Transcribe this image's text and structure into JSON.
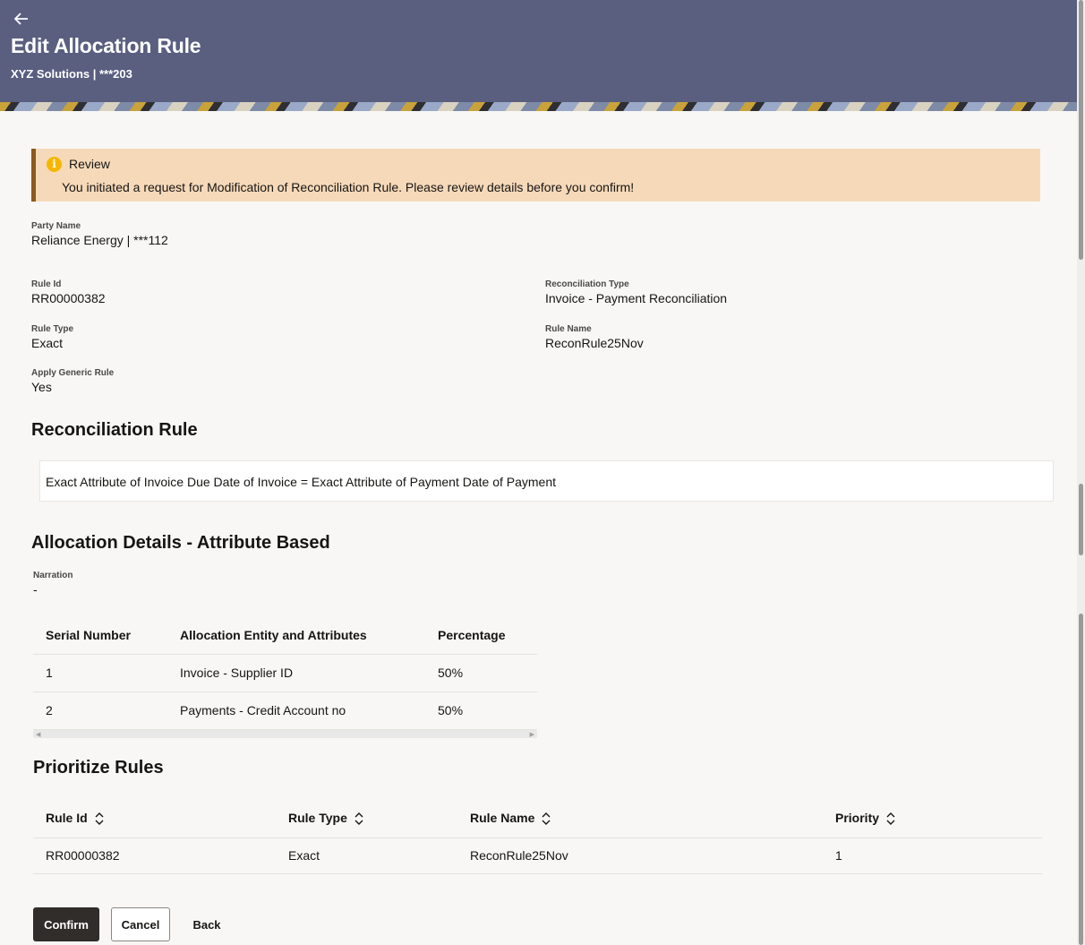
{
  "header": {
    "title": "Edit Allocation Rule",
    "subtitle": "XYZ Solutions | ***203"
  },
  "review": {
    "title": "Review",
    "message": "You initiated a request for Modification of Reconciliation Rule. Please review details before you confirm!"
  },
  "details": {
    "party_name_label": "Party Name",
    "party_name_value": "Reliance Energy | ***112",
    "rule_id_label": "Rule Id",
    "rule_id_value": "RR00000382",
    "recon_type_label": "Reconciliation Type",
    "recon_type_value": "Invoice - Payment Reconciliation",
    "rule_type_label": "Rule Type",
    "rule_type_value": "Exact",
    "rule_name_label": "Rule Name",
    "rule_name_value": "ReconRule25Nov",
    "apply_generic_label": "Apply Generic Rule",
    "apply_generic_value": "Yes"
  },
  "reconciliation_rule": {
    "heading": "Reconciliation Rule",
    "text": "Exact Attribute of Invoice Due Date of Invoice = Exact Attribute of Payment Date of Payment"
  },
  "allocation": {
    "heading": "Allocation Details - Attribute Based",
    "narration_label": "Narration",
    "narration_value": "-",
    "columns": [
      "Serial Number",
      "Allocation Entity and Attributes",
      "Percentage"
    ],
    "rows": [
      {
        "serial": "1",
        "entity": "Invoice - Supplier ID",
        "percentage": "50%"
      },
      {
        "serial": "2",
        "entity": "Payments - Credit Account no",
        "percentage": "50%"
      }
    ]
  },
  "prioritize": {
    "heading": "Prioritize Rules",
    "columns": [
      "Rule Id",
      "Rule Type",
      "Rule Name",
      "Priority"
    ],
    "rows": [
      {
        "rule_id": "RR00000382",
        "rule_type": "Exact",
        "rule_name": "ReconRule25Nov",
        "priority": "1"
      }
    ]
  },
  "actions": {
    "confirm": "Confirm",
    "cancel": "Cancel",
    "back": "Back"
  },
  "icons": {
    "back": "arrow-left-icon",
    "info": "info-icon",
    "sort": "sort-updown-icon"
  },
  "colors": {
    "header_bg": "#5a5f80",
    "review_bg": "#f6d9b9",
    "review_accent": "#8b5a1d",
    "info_icon": "#f5b700",
    "primary_button": "#312d2a"
  }
}
